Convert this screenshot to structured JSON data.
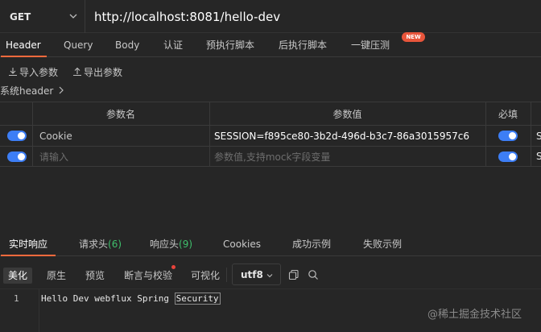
{
  "request": {
    "method": "GET",
    "url": "http://localhost:8081/hello-dev"
  },
  "request_tabs": [
    {
      "label": "Header",
      "active": true
    },
    {
      "label": "Query"
    },
    {
      "label": "Body"
    },
    {
      "label": "认证"
    },
    {
      "label": "预执行脚本"
    },
    {
      "label": "后执行脚本"
    },
    {
      "label": "一键压测",
      "badge": "NEW"
    }
  ],
  "actions": {
    "import": "导入参数",
    "export": "导出参数"
  },
  "system_header": "系统header",
  "table": {
    "columns": [
      "参数名",
      "参数值",
      "必填"
    ],
    "rows": [
      {
        "enabled": true,
        "name": "Cookie",
        "value": "SESSION=f895ce80-3b2d-496d-b3c7-86a3015957c6",
        "required": true,
        "extra": "S"
      },
      {
        "enabled": true,
        "name": "",
        "name_placeholder": "请输入",
        "value": "",
        "value_placeholder": "参数值,支持mock字段变量",
        "required": true,
        "extra": "S"
      }
    ]
  },
  "response_tabs": [
    {
      "label": "实时响应",
      "active": true
    },
    {
      "label": "请求头",
      "count": "(6)"
    },
    {
      "label": "响应头",
      "count": "(9)"
    },
    {
      "label": "Cookies"
    },
    {
      "label": "成功示例"
    },
    {
      "label": "失败示例"
    }
  ],
  "format_tabs": [
    "美化",
    "原生",
    "预览",
    "断言与校验",
    "可视化"
  ],
  "encoding": "utf8",
  "editor": {
    "line_number": "1",
    "code_before": "Hello Dev webflux Spring ",
    "code_selected": "Security"
  },
  "watermark": "@稀土掘金技术社区",
  "colors": {
    "accent": "#ff6a3d",
    "toggle": "#3d7ef5",
    "count_green": "#3fbf6c",
    "background": "#262626"
  }
}
